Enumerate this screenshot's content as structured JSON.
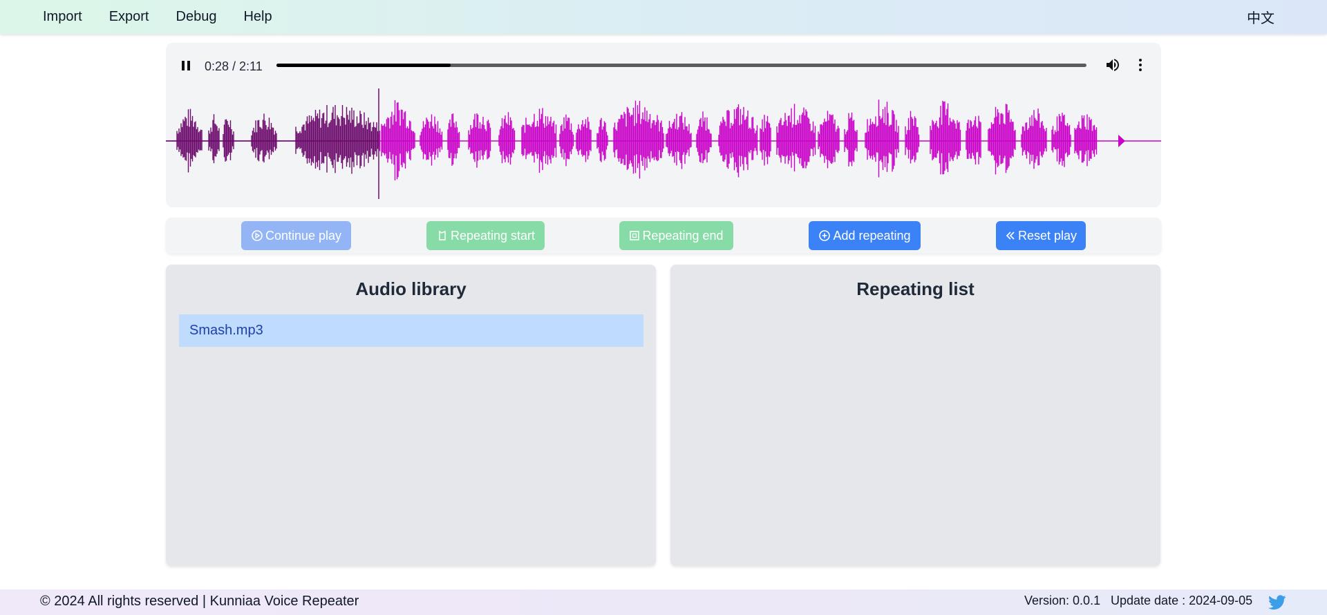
{
  "nav": {
    "menu": [
      {
        "label": "Import"
      },
      {
        "label": "Export"
      },
      {
        "label": "Debug"
      },
      {
        "label": "Help"
      }
    ],
    "language": "中文"
  },
  "player": {
    "time": "0:28 / 2:11",
    "progress": 0.215,
    "state": "playing",
    "icons": [
      "pause-icon",
      "volume-icon",
      "more-vertical-icon"
    ],
    "waveform": {
      "played_color": "#6b0a6b",
      "unplayed_color": "#c800c8",
      "played_fraction": 0.215
    }
  },
  "controls": {
    "continue_play": "Continue play",
    "repeating_start": "Repeating start",
    "repeating_end": "Repeating end",
    "add_repeating": "Add repeating",
    "reset_play": "Reset play",
    "colors": {
      "disabled_blue": "#93b4f5",
      "green": "#86dba6",
      "blue": "#3b82f6"
    }
  },
  "library": {
    "title": "Audio library",
    "items": [
      {
        "name": "Smash.mp3",
        "selected": true
      }
    ]
  },
  "repeating": {
    "title": "Repeating list",
    "items": []
  },
  "footer": {
    "copyright": "© 2024 All rights reserved | Kunniaa Voice Repeater",
    "version": "Version: 0.0.1",
    "update_date": "Update date : 2024-09-05",
    "icon": "twitter-icon"
  }
}
